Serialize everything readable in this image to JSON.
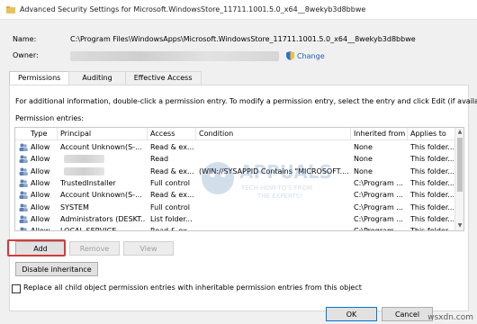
{
  "window": {
    "title": "Advanced Security Settings for Microsoft.WindowsStore_11711.1001.5.0_x64__8wekyb3d8bbwe"
  },
  "info": {
    "name_label": "Name:",
    "name_value": "C:\\Program Files\\WindowsApps\\Microsoft.WindowsStore_11711.1001.5.0_x64__8wekyb3d8bbwe",
    "owner_label": "Owner:",
    "change_link": "Change"
  },
  "tabs": [
    {
      "label": "Permissions",
      "active": true
    },
    {
      "label": "Auditing",
      "active": false
    },
    {
      "label": "Effective Access",
      "active": false
    }
  ],
  "hint": "For additional information, double-click a permission entry. To modify a permission entry, select the entry and click Edit (if available).",
  "permission_entries_label": "Permission entries:",
  "table": {
    "columns": [
      "Type",
      "Principal",
      "Access",
      "Condition",
      "Inherited from",
      "Applies to"
    ],
    "rows": [
      {
        "type": "Allow",
        "principal": "Account Unknown(S-...",
        "access": "Read & ex...",
        "condition": "",
        "inherited": "None",
        "applies": "This folder..."
      },
      {
        "type": "Allow",
        "principal": "",
        "access": "Read",
        "condition": "",
        "inherited": "None",
        "applies": "This folder..."
      },
      {
        "type": "Allow",
        "principal": "",
        "access": "Read & ex...",
        "condition": "(WIN://SYSAPPID Contains \"MICROSOFT....",
        "inherited": "None",
        "applies": "This folder..."
      },
      {
        "type": "Allow",
        "principal": "TrustedInstaller",
        "access": "Full control",
        "condition": "",
        "inherited": "C:\\Program ...",
        "applies": "This folder..."
      },
      {
        "type": "Allow",
        "principal": "Account Unknown(S-...",
        "access": "Read & ex...",
        "condition": "",
        "inherited": "C:\\Program ...",
        "applies": "This folder..."
      },
      {
        "type": "Allow",
        "principal": "SYSTEM",
        "access": "Full control",
        "condition": "",
        "inherited": "C:\\Program ...",
        "applies": "This folder..."
      },
      {
        "type": "Allow",
        "principal": "Administrators (DESKT...",
        "access": "List folder...",
        "condition": "",
        "inherited": "C:\\Program ...",
        "applies": "This folder..."
      },
      {
        "type": "Allow",
        "principal": "LOCAL SERVICE",
        "access": "Read & ex...",
        "condition": "",
        "inherited": "C:\\Program ...",
        "applies": "This folder..."
      }
    ]
  },
  "buttons": {
    "add": "Add",
    "remove": "Remove",
    "view": "View",
    "disable_inheritance": "Disable inheritance"
  },
  "replace_checkbox": {
    "label": "Replace all child object permission entries with inheritable permission entries from this object",
    "checked": false
  },
  "footer": {
    "ok": "OK",
    "cancel": "Cancel",
    "apply": "Apply"
  },
  "watermark": {
    "line1": "APPUALS",
    "line2": "TECH HOW-TO'S FROM",
    "line3": "THE EXPERTS!"
  },
  "site_mark": "wsxdn.com",
  "colors": {
    "highlight": "#d43a3a",
    "link": "#1c5fb3"
  }
}
